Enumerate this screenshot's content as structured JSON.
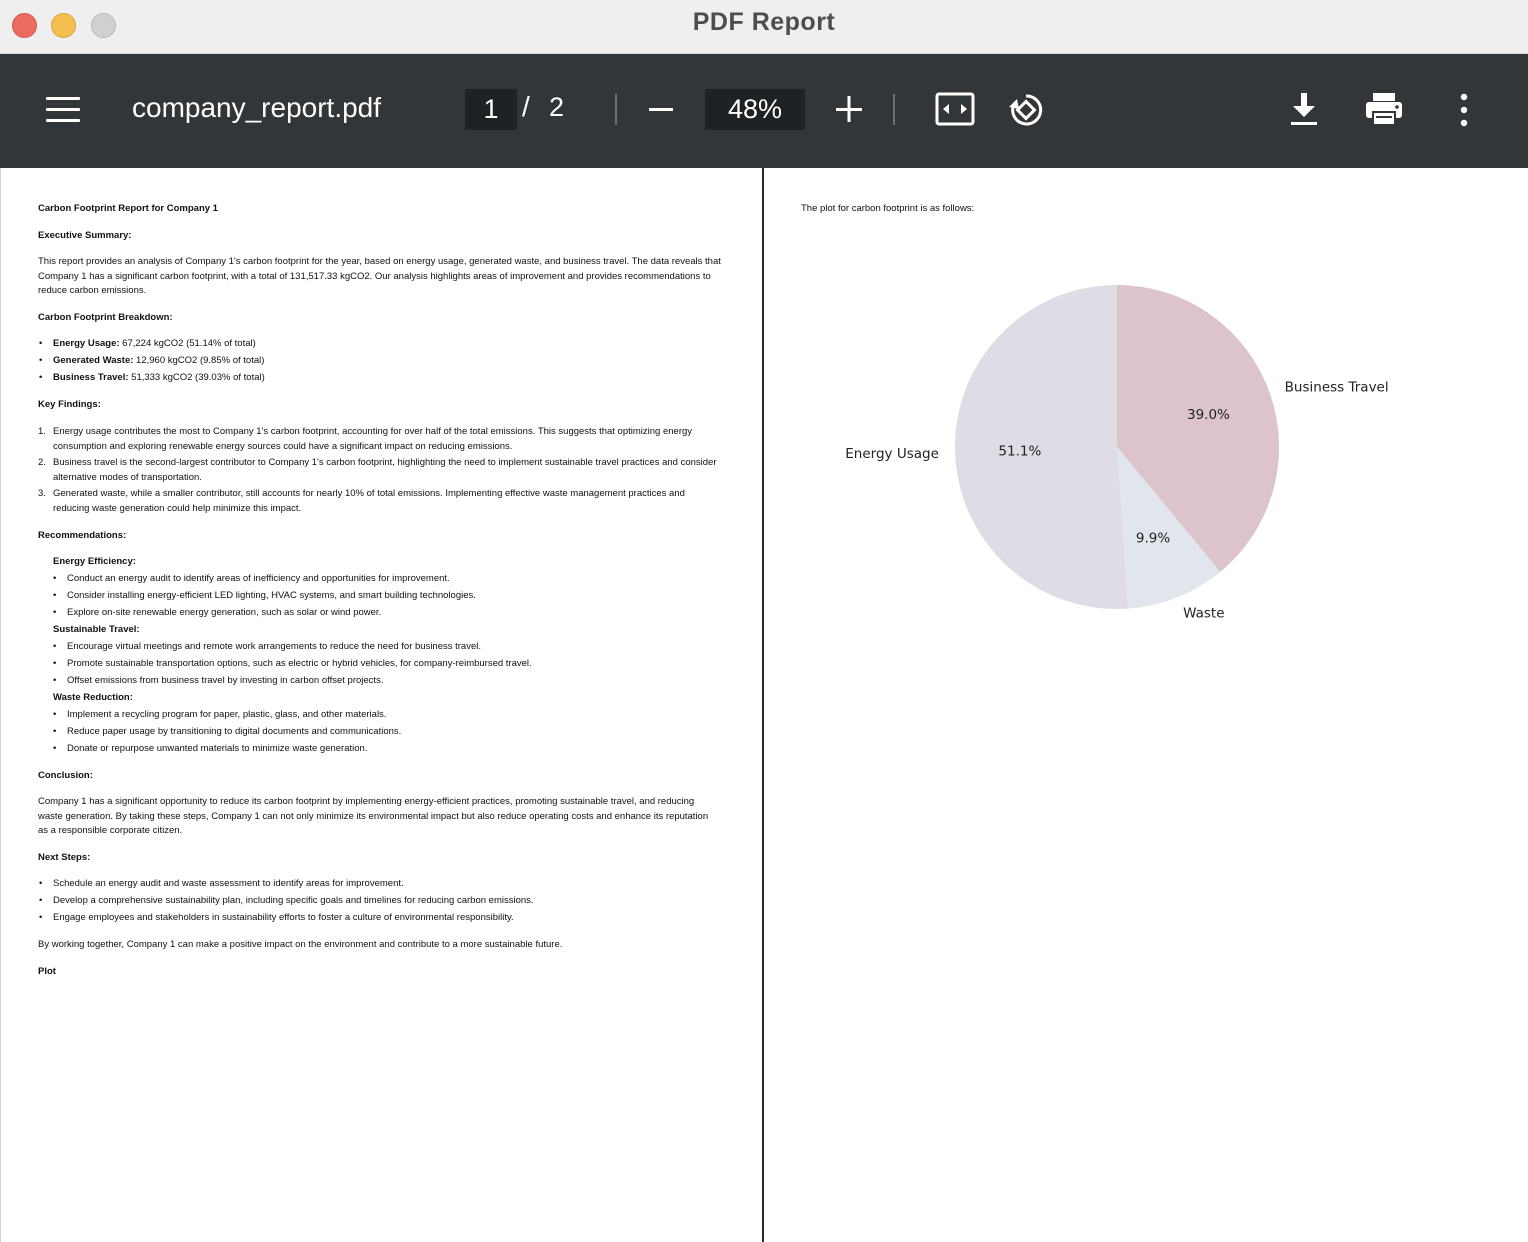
{
  "window": {
    "title": "PDF Report"
  },
  "toolbar": {
    "file_name": "company_report.pdf",
    "current_page": "1",
    "page_separator": "/",
    "total_pages": "2",
    "zoom": "48%"
  },
  "report": {
    "title": "Carbon Footprint Report for Company 1",
    "exec_heading": "Executive Summary:",
    "exec_body": "This report provides an analysis of Company 1's carbon footprint for the year, based on energy usage, generated waste, and business travel. The data reveals that Company 1 has a significant carbon footprint, with a total of 131,517.33 kgCO2. Our analysis highlights areas of improvement and provides recommendations to reduce carbon emissions.",
    "breakdown_heading": "Carbon Footprint Breakdown:",
    "breakdown": [
      {
        "label": "Energy Usage:",
        "value": " 67,224 kgCO2 (51.14% of total)"
      },
      {
        "label": "Generated Waste:",
        "value": " 12,960 kgCO2 (9.85% of total)"
      },
      {
        "label": "Business Travel:",
        "value": " 51,333 kgCO2 (39.03% of total)"
      }
    ],
    "findings_heading": "Key Findings:",
    "findings": [
      {
        "num": "1.",
        "text": "Energy usage contributes the most to Company 1's carbon footprint, accounting for over half of the total emissions. This suggests that optimizing energy consumption and exploring renewable energy sources could have a significant impact on reducing emissions."
      },
      {
        "num": "2.",
        "text": "Business travel is the second-largest contributor to Company 1's carbon footprint, highlighting the need to implement sustainable travel practices and consider alternative modes of transportation."
      },
      {
        "num": "3.",
        "text": "Generated waste, while a smaller contributor, still accounts for nearly 10% of total emissions. Implementing effective waste management practices and reducing waste generation could help minimize this impact."
      }
    ],
    "recs_heading": "Recommendations:",
    "recs": [
      {
        "heading": "Energy Efficiency:",
        "items": [
          "Conduct an energy audit to identify areas of inefficiency and opportunities for improvement.",
          "Consider installing energy-efficient LED lighting, HVAC systems, and smart building technologies.",
          "Explore on-site renewable energy generation, such as solar or wind power."
        ]
      },
      {
        "heading": "Sustainable Travel:",
        "items": [
          "Encourage virtual meetings and remote work arrangements to reduce the need for business travel.",
          "Promote sustainable transportation options, such as electric or hybrid vehicles, for company-reimbursed travel.",
          "Offset emissions from business travel by investing in carbon offset projects."
        ]
      },
      {
        "heading": "Waste Reduction:",
        "items": [
          "Implement a recycling program for paper, plastic, glass, and other materials.",
          "Reduce paper usage by transitioning to digital documents and communications.",
          "Donate or repurpose unwanted materials to minimize waste generation."
        ]
      }
    ],
    "conclusion_heading": "Conclusion:",
    "conclusion_body": "Company 1 has a significant opportunity to reduce its carbon footprint by implementing energy-efficient practices, promoting sustainable travel, and reducing waste generation. By taking these steps, Company 1 can not only minimize its environmental impact but also reduce operating costs and enhance its reputation as a responsible corporate citizen.",
    "next_heading": "Next Steps:",
    "next_steps": [
      "Schedule an energy audit and waste assessment to identify areas for improvement.",
      "Develop a comprehensive sustainability plan, including specific goals and timelines for reducing carbon emissions.",
      "Engage employees and stakeholders in sustainability efforts to foster a culture of environmental responsibility."
    ],
    "closing": "By working together, Company 1 can make a positive impact on the environment and contribute to a more sustainable future.",
    "plot_heading": "Plot"
  },
  "page2": {
    "intro": "The plot for carbon footprint is as follows:"
  },
  "chart_data": {
    "type": "pie",
    "categories": [
      "Business Travel",
      "Waste",
      "Energy Usage"
    ],
    "values": [
      39.0,
      9.9,
      51.1
    ],
    "labels_pct": [
      "39.0%",
      "9.9%",
      "51.1%"
    ],
    "colors": [
      "#dcc3cd",
      "#e1e5ec",
      "#dfdce6"
    ],
    "start_angle_deg": 90,
    "direction": "clockwise"
  }
}
